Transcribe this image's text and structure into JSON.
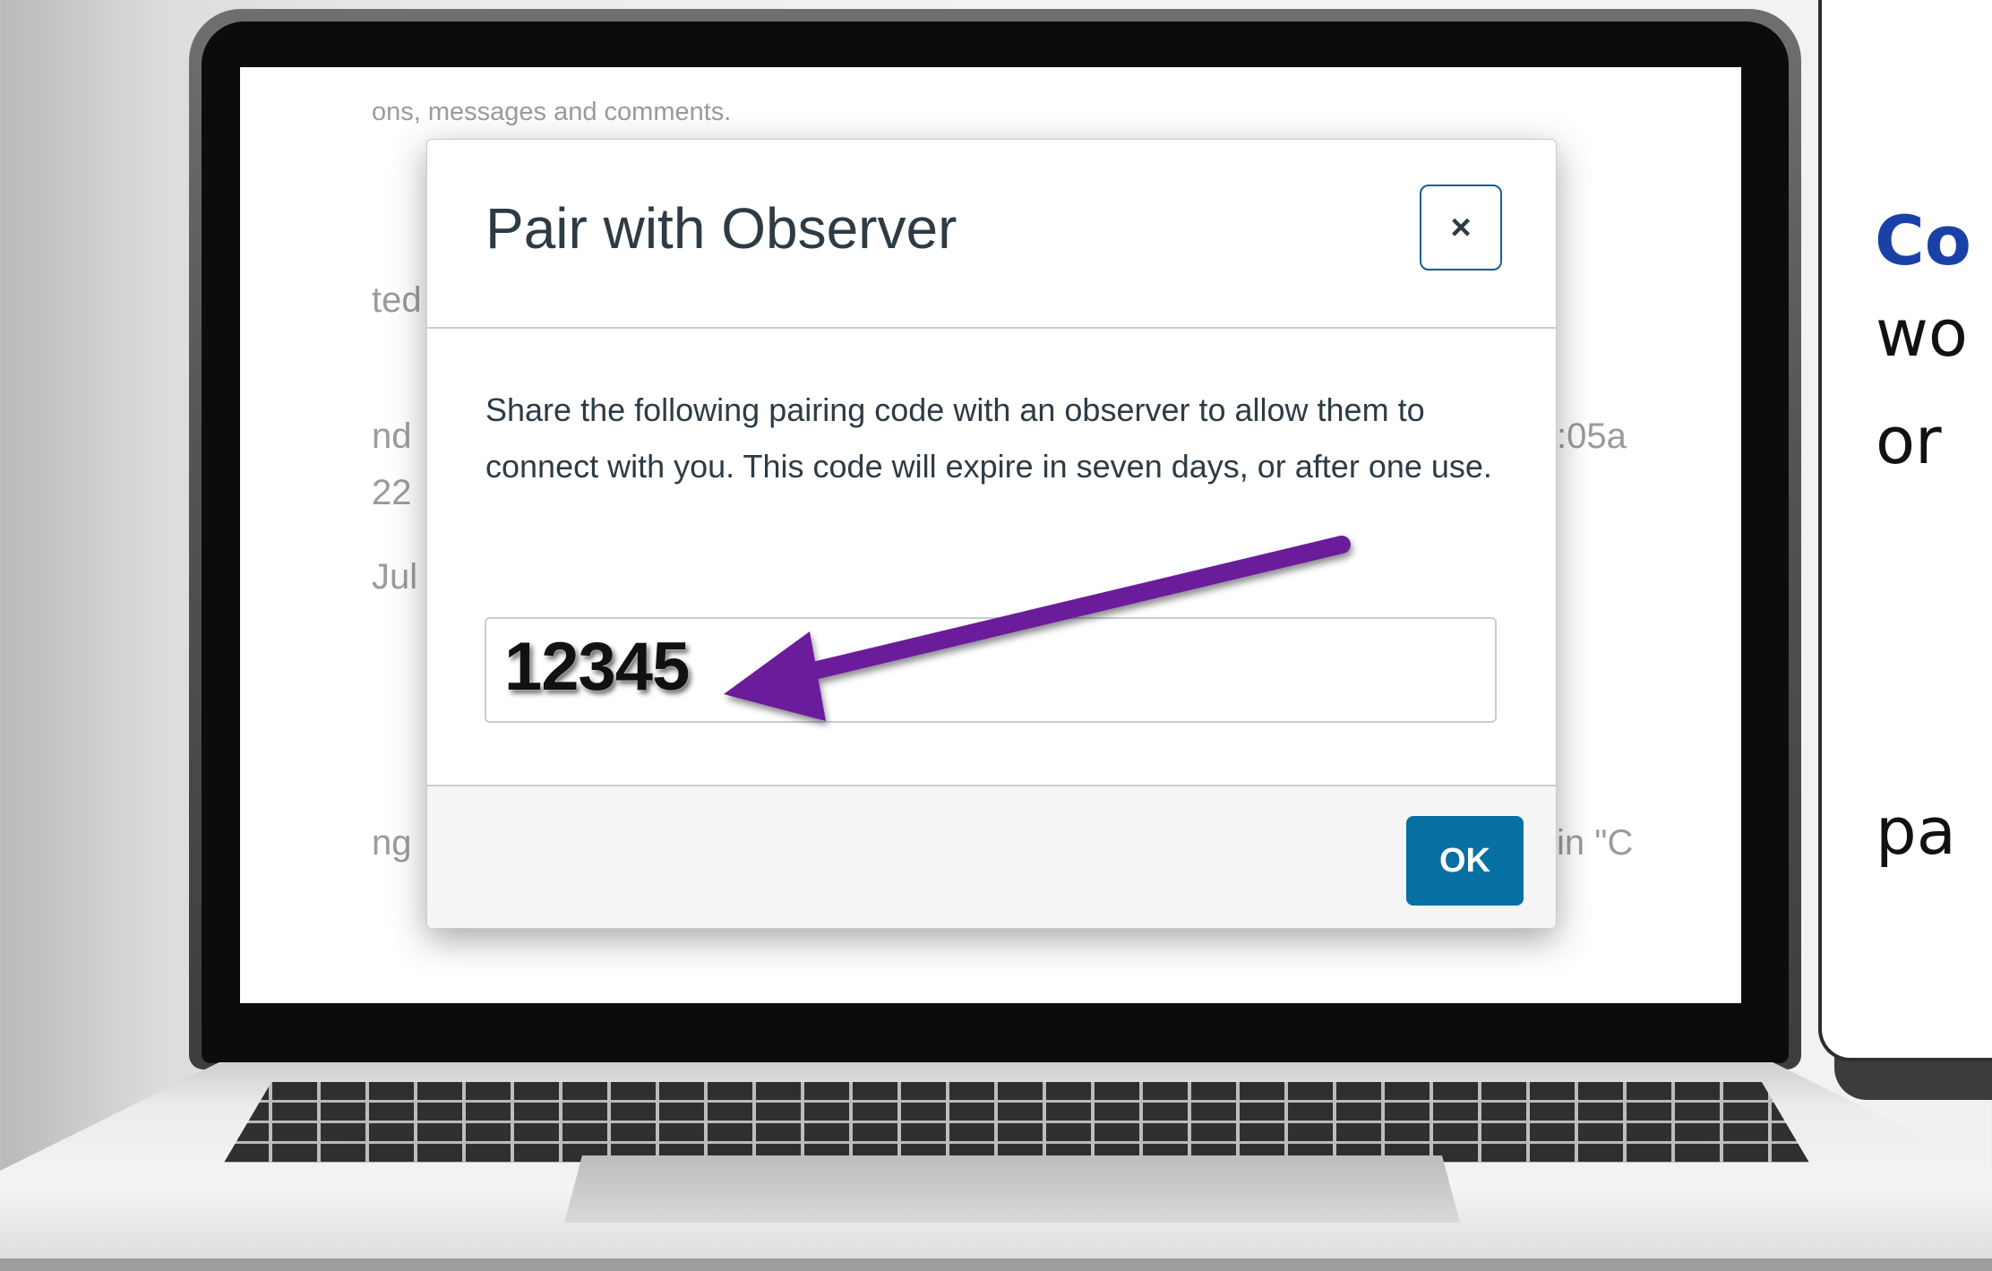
{
  "background_page": {
    "fragments": [
      "ons, messages and comments.",
      "ted",
      "nd",
      "22",
      "Jul",
      "ng",
      ":05a",
      "in \"C"
    ]
  },
  "modal": {
    "title": "Pair with Observer",
    "close_label": "×",
    "description": "Share the following pairing code with an observer to allow them to connect with you. This code will expire in seven days, or after one use.",
    "pairing_code": "12345",
    "ok_label": "OK"
  },
  "side_card": {
    "title_fragment": "Co",
    "line_1": "wo",
    "line_2": "or",
    "line_3": "pa"
  },
  "colors": {
    "arrow": "#6a1b9a",
    "ok_button": "#0770a3",
    "card_title": "#1a41a8"
  }
}
